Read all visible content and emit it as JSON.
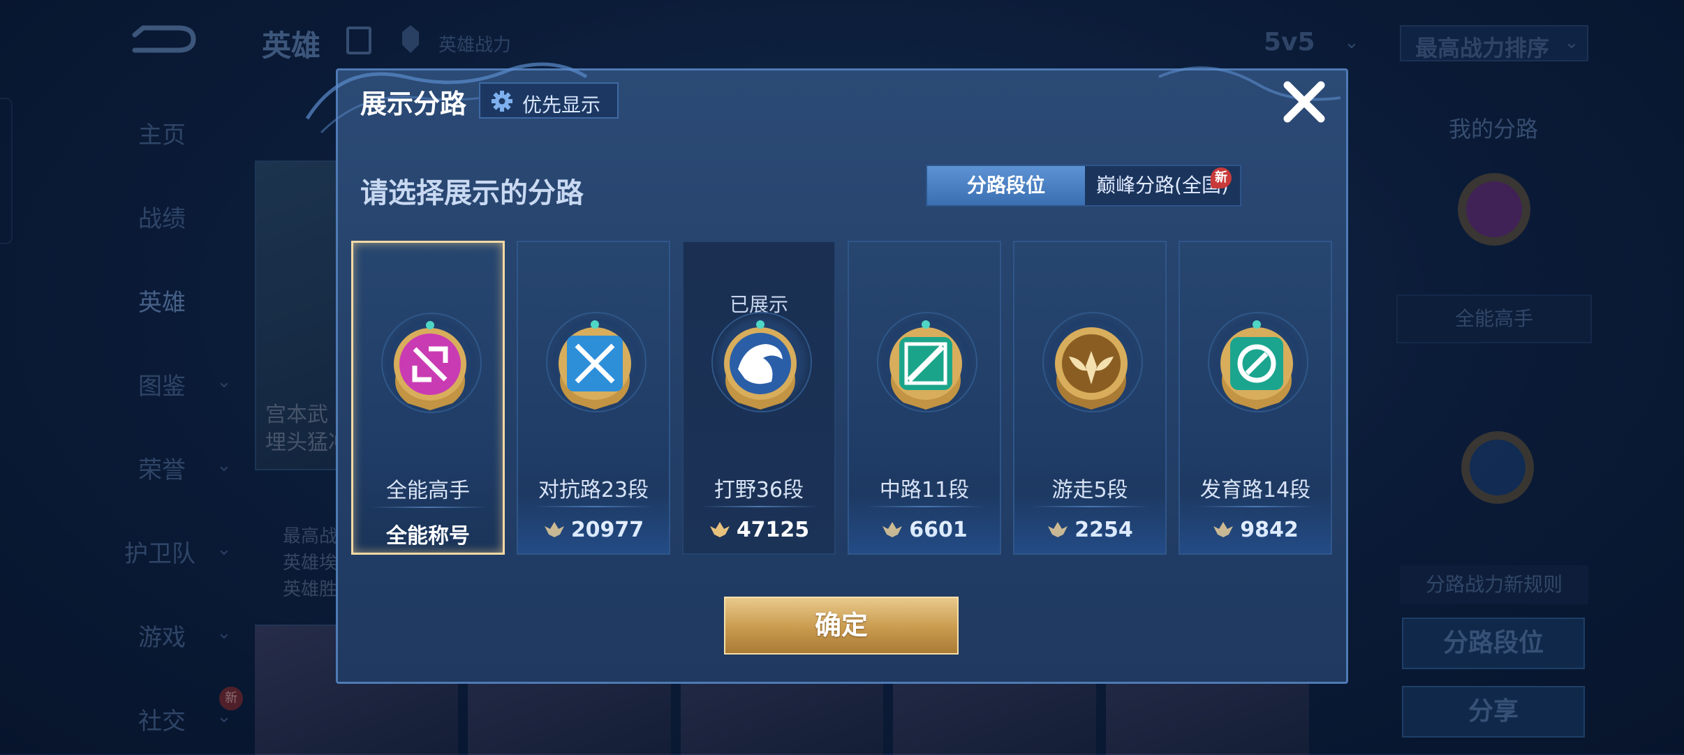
{
  "background": {
    "title": "英雄",
    "power_label": "英雄战力",
    "mode": "5v5",
    "sort": "最高战力排序",
    "nav": [
      {
        "label": "主页"
      },
      {
        "label": "战绩"
      },
      {
        "label": "英雄"
      },
      {
        "label": "图鉴"
      },
      {
        "label": "荣誉"
      },
      {
        "label": "护卫队"
      },
      {
        "label": "游戏"
      },
      {
        "label": "社交",
        "badge": "新"
      }
    ],
    "card_text_1": "宫本武",
    "card_text_2": "埋头猛冲",
    "card_lines": [
      "最高战",
      "英雄埃",
      "英雄胜"
    ],
    "right_panel": {
      "title": "我的分路",
      "label": "全能高手",
      "rule": "分路战力新规则",
      "btn_lane": "分路段位",
      "btn_share": "分享"
    }
  },
  "modal": {
    "title": "展示分路",
    "priority_label": "优先显示",
    "prompt": "请选择展示的分路",
    "tabs": {
      "selected": "分路段位",
      "other": "巅峰分路(全国)",
      "new_badge": "新"
    },
    "cards": [
      {
        "name": "全能高手",
        "value": "全能称号",
        "selected": true,
        "emblem": "allround-emblem",
        "color": "#c93bb3"
      },
      {
        "name": "对抗路23段",
        "value": "20977",
        "emblem": "clash-lane-emblem",
        "color": "#2e8fd9"
      },
      {
        "name": "打野36段",
        "value": "47125",
        "shown_tag": "已展示",
        "emblem": "jungle-emblem",
        "color": "#2a5fa8"
      },
      {
        "name": "中路11段",
        "value": "6601",
        "emblem": "mid-lane-emblem",
        "color": "#1aa58a"
      },
      {
        "name": "游走5段",
        "value": "2254",
        "emblem": "roam-emblem",
        "color": "#b0813a"
      },
      {
        "name": "发育路14段",
        "value": "9842",
        "emblem": "farm-lane-emblem",
        "color": "#1ba58f"
      }
    ],
    "confirm": "确定"
  },
  "colors": {
    "accent_gold": "#c99a4e",
    "selected_border": "#f3d9a4",
    "modal_bg": "#2b4a75"
  }
}
